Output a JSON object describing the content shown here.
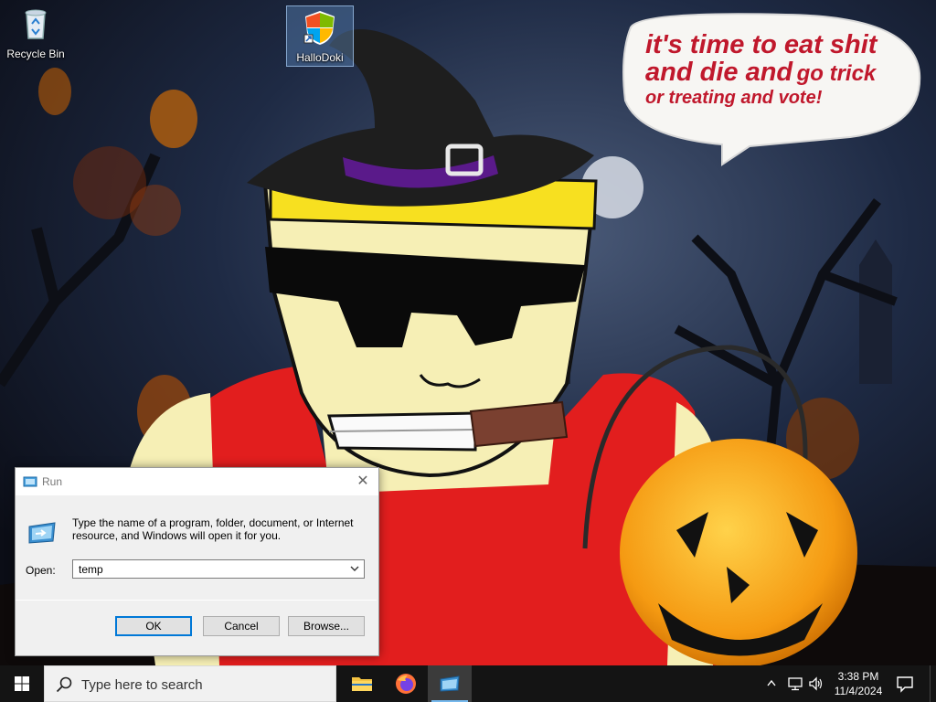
{
  "desktop": {
    "icons": [
      {
        "label": "Recycle Bin",
        "icon": "recycle-bin-icon"
      },
      {
        "label": "HalloDoki",
        "icon": "shield-app-icon",
        "selected": true
      }
    ]
  },
  "wallpaper": {
    "speech_bubble": {
      "line1": "it's time to eat shit",
      "line2a": "and die and",
      "line2b": "go trick",
      "line3": "or treating and vote!"
    },
    "colors": {
      "bubble_text": "#c0182c",
      "sky": "#1b2640"
    }
  },
  "run_dialog": {
    "title": "Run",
    "description": "Type the name of a program, folder, document, or Internet resource, and Windows will open it for you.",
    "open_label": "Open:",
    "open_value": "temp",
    "buttons": {
      "ok": "OK",
      "cancel": "Cancel",
      "browse": "Browse..."
    }
  },
  "taskbar": {
    "search_placeholder": "Type here to search",
    "apps": [
      "File Explorer",
      "Firefox",
      "Run"
    ],
    "clock": {
      "time": "3:38 PM",
      "date": "11/4/2024"
    },
    "accent": "#76b9ed"
  }
}
